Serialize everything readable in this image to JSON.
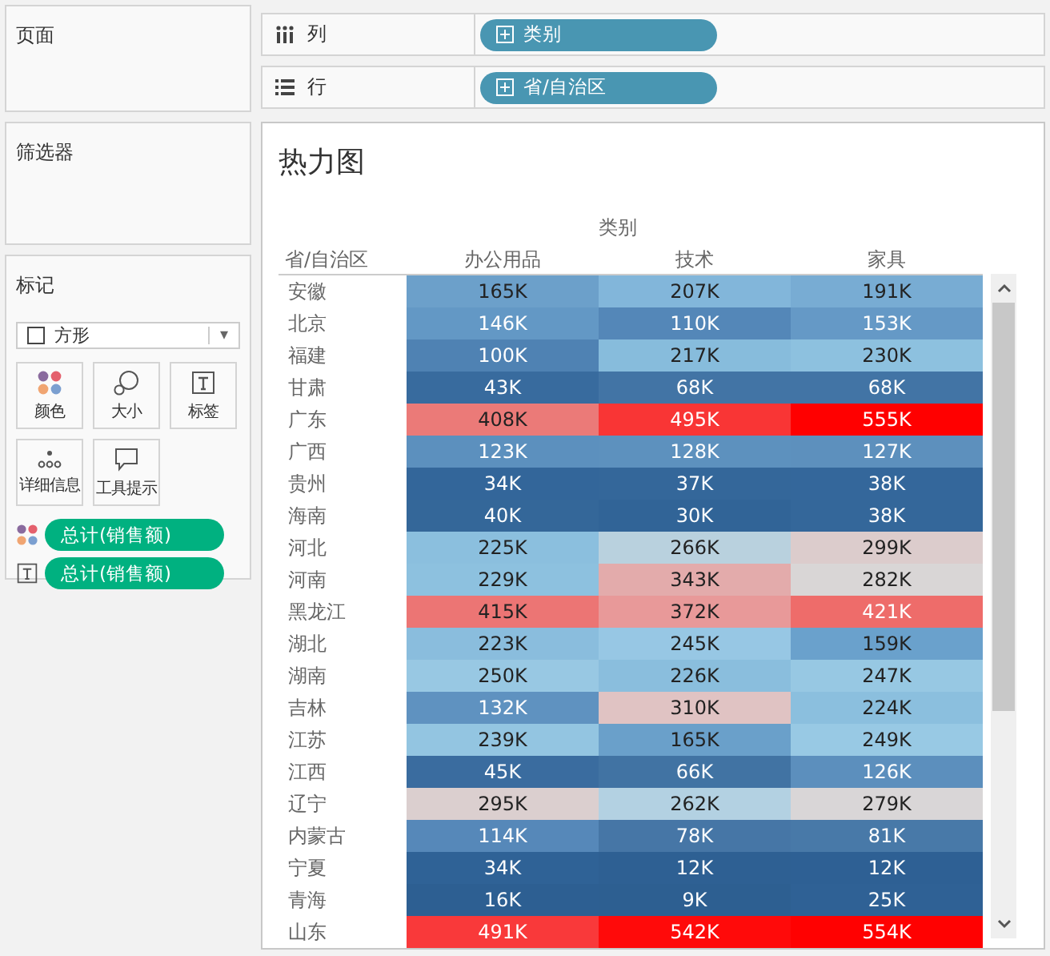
{
  "panels": {
    "pages": "页面",
    "filters": "筛选器",
    "marks": "标记"
  },
  "mark_type": {
    "label": "方形",
    "caret": "▾"
  },
  "mark_cards": [
    {
      "kind": "color",
      "label": "颜色"
    },
    {
      "kind": "size",
      "label": "大小"
    },
    {
      "kind": "label",
      "label": "标签"
    },
    {
      "kind": "detail",
      "label": "详细信息"
    },
    {
      "kind": "tooltip",
      "label": "工具提示"
    }
  ],
  "mark_fields": [
    {
      "kind": "color",
      "label": "总计(销售额)"
    },
    {
      "kind": "label",
      "label": "总计(销售额)"
    }
  ],
  "shelves": [
    {
      "kind": "columns",
      "label": "列",
      "pill": "类别"
    },
    {
      "kind": "rows",
      "label": "行",
      "pill": "省/自治区"
    }
  ],
  "view": {
    "title": "热力图",
    "column_group": "类别",
    "row_header": "省/自治区",
    "columns": [
      "办公用品",
      "技术",
      "家具"
    ],
    "rows": [
      {
        "label": "安徽",
        "cells": [
          {
            "value": "165K",
            "color": "#6ca0ca"
          },
          {
            "value": "207K",
            "color": "#82b6da"
          },
          {
            "value": "191K",
            "color": "#78acd3"
          }
        ]
      },
      {
        "label": "北京",
        "cells": [
          {
            "value": "146K",
            "color": "#6398c5"
          },
          {
            "value": "110K",
            "color": "#5487b8"
          },
          {
            "value": "153K",
            "color": "#6599c6"
          }
        ]
      },
      {
        "label": "福建",
        "cells": [
          {
            "value": "100K",
            "color": "#4f82b3"
          },
          {
            "value": "217K",
            "color": "#87bcdc"
          },
          {
            "value": "230K",
            "color": "#8dc1df"
          }
        ]
      },
      {
        "label": "甘肃",
        "cells": [
          {
            "value": "43K",
            "color": "#386b9e"
          },
          {
            "value": "68K",
            "color": "#4274a5"
          },
          {
            "value": "68K",
            "color": "#4274a5"
          }
        ]
      },
      {
        "label": "广东",
        "cells": [
          {
            "value": "408K",
            "color": "#eb7a78"
          },
          {
            "value": "495K",
            "color": "#f93535"
          },
          {
            "value": "555K",
            "color": "#ff0000"
          }
        ]
      },
      {
        "label": "广西",
        "cells": [
          {
            "value": "123K",
            "color": "#5c90be"
          },
          {
            "value": "128K",
            "color": "#5d91be"
          },
          {
            "value": "127K",
            "color": "#5d90bd"
          }
        ]
      },
      {
        "label": "贵州",
        "cells": [
          {
            "value": "34K",
            "color": "#33669a"
          },
          {
            "value": "37K",
            "color": "#34679a"
          },
          {
            "value": "38K",
            "color": "#34679b"
          }
        ]
      },
      {
        "label": "海南",
        "cells": [
          {
            "value": "40K",
            "color": "#346799"
          },
          {
            "value": "30K",
            "color": "#316497"
          },
          {
            "value": "38K",
            "color": "#34679a"
          }
        ]
      },
      {
        "label": "河北",
        "cells": [
          {
            "value": "225K",
            "color": "#8bbfde"
          },
          {
            "value": "266K",
            "color": "#b9d1de"
          },
          {
            "value": "299K",
            "color": "#dccccc"
          }
        ]
      },
      {
        "label": "河南",
        "cells": [
          {
            "value": "229K",
            "color": "#8dc1df"
          },
          {
            "value": "343K",
            "color": "#e3abab"
          },
          {
            "value": "282K",
            "color": "#d9d6d6"
          }
        ]
      },
      {
        "label": "黑龙江",
        "cells": [
          {
            "value": "415K",
            "color": "#ec7574"
          },
          {
            "value": "372K",
            "color": "#e89999"
          },
          {
            "value": "421K",
            "color": "#ee6c6a"
          }
        ]
      },
      {
        "label": "湖北",
        "cells": [
          {
            "value": "223K",
            "color": "#8abddd"
          },
          {
            "value": "245K",
            "color": "#97c7e4"
          },
          {
            "value": "159K",
            "color": "#6aa1cc"
          }
        ]
      },
      {
        "label": "湖南",
        "cells": [
          {
            "value": "250K",
            "color": "#98c8e3"
          },
          {
            "value": "226K",
            "color": "#8abedd"
          },
          {
            "value": "247K",
            "color": "#97c8e3"
          }
        ]
      },
      {
        "label": "吉林",
        "cells": [
          {
            "value": "132K",
            "color": "#5f92c0"
          },
          {
            "value": "310K",
            "color": "#e0c3c3"
          },
          {
            "value": "224K",
            "color": "#8bbfde"
          }
        ]
      },
      {
        "label": "江苏",
        "cells": [
          {
            "value": "239K",
            "color": "#93c5e1"
          },
          {
            "value": "165K",
            "color": "#6aa0ca"
          },
          {
            "value": "249K",
            "color": "#98c9e4"
          }
        ]
      },
      {
        "label": "江西",
        "cells": [
          {
            "value": "45K",
            "color": "#3a6c9f"
          },
          {
            "value": "66K",
            "color": "#4173a3"
          },
          {
            "value": "126K",
            "color": "#5c8fbd"
          }
        ]
      },
      {
        "label": "辽宁",
        "cells": [
          {
            "value": "295K",
            "color": "#dbcfcf"
          },
          {
            "value": "262K",
            "color": "#b3d1e2"
          },
          {
            "value": "279K",
            "color": "#d9d6d7"
          }
        ]
      },
      {
        "label": "内蒙古",
        "cells": [
          {
            "value": "114K",
            "color": "#5688b9"
          },
          {
            "value": "78K",
            "color": "#4676a6"
          },
          {
            "value": "81K",
            "color": "#4879a8"
          }
        ]
      },
      {
        "label": "宁夏",
        "cells": [
          {
            "value": "34K",
            "color": "#2f6296"
          },
          {
            "value": "12K",
            "color": "#2e6093"
          },
          {
            "value": "12K",
            "color": "#2e6094"
          }
        ]
      },
      {
        "label": "青海",
        "cells": [
          {
            "value": "16K",
            "color": "#2d5f92"
          },
          {
            "value": "9K",
            "color": "#2d5f91"
          },
          {
            "value": "25K",
            "color": "#2f6195"
          }
        ]
      },
      {
        "label": "山东",
        "cells": [
          {
            "value": "491K",
            "color": "#f9393a"
          },
          {
            "value": "542K",
            "color": "#ff0a0a"
          },
          {
            "value": "554K",
            "color": "#ff0101"
          }
        ]
      }
    ]
  }
}
